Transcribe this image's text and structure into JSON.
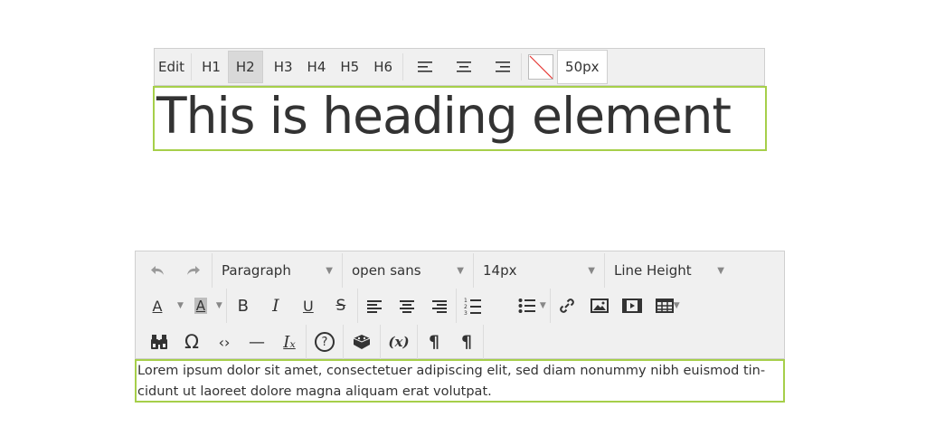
{
  "heading_editor": {
    "toolbar": {
      "edit_label": "Edit",
      "levels": [
        "H1",
        "H2",
        "H3",
        "H4",
        "H5",
        "H6"
      ],
      "active_level": "H2",
      "font_size": "50px"
    },
    "heading_text": "This is heading element",
    "accent_color": "#a6cf4a"
  },
  "rich_editor": {
    "toolbar": {
      "block_format": "Paragraph",
      "font_family": "open sans",
      "font_size": "14px",
      "line_height": "Line Height",
      "text_color_glyph": "A",
      "bg_color_glyph": "A",
      "bold_glyph": "B",
      "italic_glyph": "I",
      "underline_glyph": "U",
      "strike_glyph": "S",
      "omega_glyph": "Ω",
      "code_glyph": "‹›",
      "hr_glyph": "—",
      "clear_glyph": "Iₓ",
      "help_glyph": "?",
      "var_glyph": "(x)",
      "ltr_glyph": "¶",
      "rtl_glyph": "¶"
    },
    "content": "Lorem ipsum dolor sit amet, consectetuer adipiscing elit, sed diam nonummy nibh euismod tin-cidunt ut laoreet dolore magna aliquam erat volutpat."
  }
}
